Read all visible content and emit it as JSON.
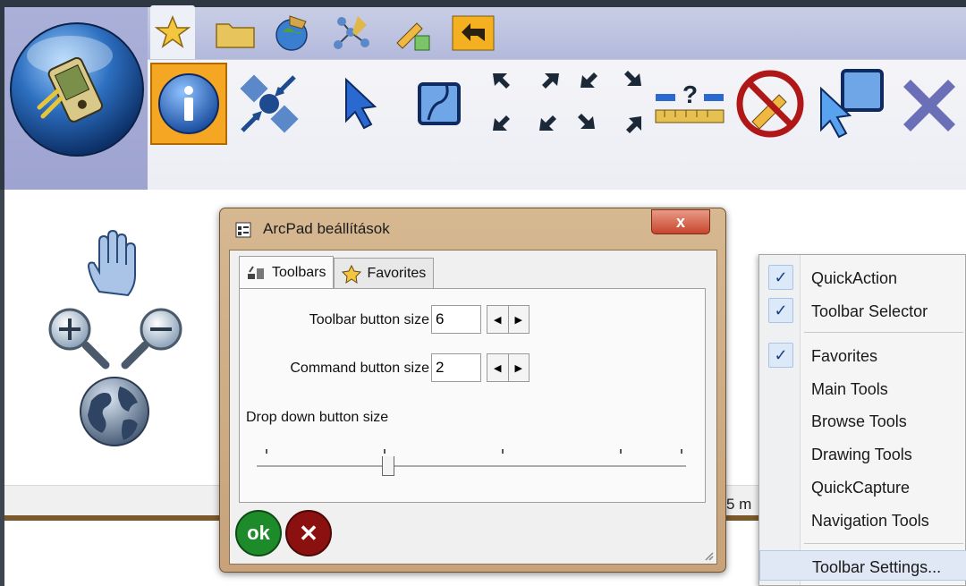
{
  "toolbar": {
    "tabs": [
      {
        "icon": "star-icon",
        "active": true
      },
      {
        "icon": "folder-icon",
        "active": false
      },
      {
        "icon": "globe-gps-icon",
        "active": false
      },
      {
        "icon": "network-icon",
        "active": false
      },
      {
        "icon": "edit-pencil-icon",
        "active": false
      },
      {
        "icon": "back-arrow-icon",
        "active": false
      }
    ],
    "tools": [
      {
        "icon": "info-icon",
        "active": true
      },
      {
        "icon": "gps-satellite-icon"
      },
      {
        "icon": "select-arrow-icon"
      },
      {
        "icon": "map-frame-icon"
      },
      {
        "icon": "zoom-arrows-icon"
      },
      {
        "icon": "measure-icon"
      },
      {
        "icon": "no-edit-icon"
      },
      {
        "icon": "select-map-icon"
      },
      {
        "icon": "close-x-icon"
      }
    ]
  },
  "status": {
    "text": "5 m"
  },
  "dialog": {
    "title": "ArcPad beállítások",
    "close_label": "x",
    "tabs": [
      {
        "label": "Toolbars",
        "active": true
      },
      {
        "label": "Favorites",
        "active": false
      }
    ],
    "fields": {
      "toolbar_button_size": {
        "label": "Toolbar button size",
        "value": "6"
      },
      "command_button_size": {
        "label": "Command button size",
        "value": "2"
      }
    },
    "slider": {
      "label": "Drop down button size",
      "tick_count": 5,
      "value": 0.3
    },
    "ok_label": "ok",
    "cancel_label": "✕"
  },
  "menu": {
    "items": [
      {
        "label": "QuickAction",
        "checked": true
      },
      {
        "label": "Toolbar Selector",
        "checked": true
      },
      {
        "label": "Favorites",
        "checked": true
      },
      {
        "label": "Main Tools",
        "checked": false
      },
      {
        "label": "Browse Tools",
        "checked": false
      },
      {
        "label": "Drawing Tools",
        "checked": false
      },
      {
        "label": "QuickCapture",
        "checked": false
      },
      {
        "label": "Navigation Tools",
        "checked": false
      },
      {
        "label": "Toolbar Settings...",
        "checked": false,
        "highlighted": true
      }
    ]
  },
  "colors": {
    "accent": "#f5a623",
    "ok": "#1e8b2a",
    "cancel": "#8b1010",
    "menu_check": "#1c3f86"
  }
}
